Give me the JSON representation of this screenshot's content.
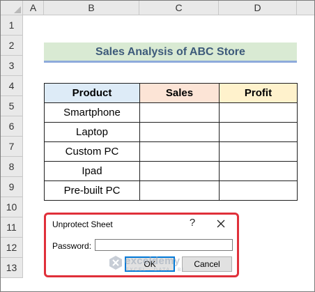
{
  "columns": [
    "A",
    "B",
    "C",
    "D"
  ],
  "rows": [
    "1",
    "2",
    "3",
    "4",
    "5",
    "6",
    "7",
    "8",
    "9",
    "10",
    "11",
    "12",
    "13"
  ],
  "sheet_title": "Sales Analysis of ABC Store",
  "table": {
    "headers": [
      "Product",
      "Sales",
      "Profit"
    ],
    "rows": [
      {
        "product": "Smartphone",
        "sales": "",
        "profit": ""
      },
      {
        "product": "Laptop",
        "sales": "",
        "profit": ""
      },
      {
        "product": "Custom PC",
        "sales": "",
        "profit": ""
      },
      {
        "product": "Ipad",
        "sales": "",
        "profit": ""
      },
      {
        "product": "Pre-built PC",
        "sales": "",
        "profit": ""
      }
    ],
    "header_colors": {
      "product": "#ddebf7",
      "sales": "#fce4d6",
      "profit": "#fff2cc"
    }
  },
  "dialog": {
    "title": "Unprotect Sheet",
    "help": "?",
    "close_icon": "close-icon",
    "password_label": "Password:",
    "password_value": "",
    "ok_label": "OK",
    "cancel_label": "Cancel",
    "highlight_color": "#e0303a"
  },
  "watermark": {
    "name": "exceldemy",
    "tagline": "EXCEL · DATA · BI"
  },
  "colors": {
    "title_fill": "#d9ead3",
    "title_underline": "#8eaadb",
    "title_text": "#3d5a7a",
    "header_gray": "#e9e9e9"
  }
}
